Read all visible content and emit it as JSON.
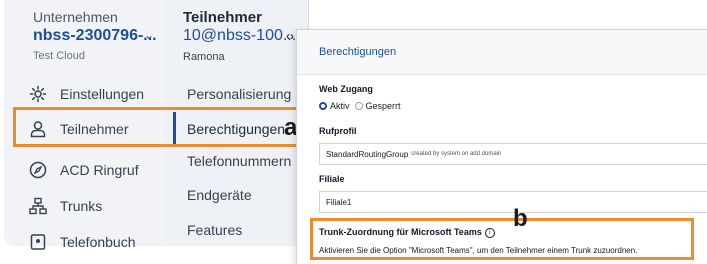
{
  "sidebar": {
    "tenant_label": "Unternehmen",
    "tenant_name": "nbss-2300796-...",
    "tenant_sub": "Test Cloud",
    "items": [
      {
        "label": "Einstellungen",
        "icon": "gear-icon"
      },
      {
        "label": "Teilnehmer",
        "icon": "user-icon"
      },
      {
        "label": "ACD Ringruf",
        "icon": "compass-icon"
      },
      {
        "label": "Trunks",
        "icon": "network-icon"
      },
      {
        "label": "Telefonbuch",
        "icon": "phonebook-icon"
      }
    ]
  },
  "submenu": {
    "title": "Teilnehmer",
    "account": "10@nbss-100...",
    "user": "Ramona",
    "items": [
      {
        "label": "Personalisierung"
      },
      {
        "label": "Berechtigungen"
      },
      {
        "label": "Telefonnummern"
      },
      {
        "label": "Endgeräte"
      },
      {
        "label": "Features"
      }
    ]
  },
  "panel": {
    "title": "Berechtigungen",
    "web_access_label": "Web Zugang",
    "web_access_options": [
      "Aktiv",
      "Gesperrt"
    ],
    "web_access_selected": "Aktiv",
    "routing_profile_label": "Rufprofil",
    "routing_profile_value": "StandardRoutingGroup",
    "routing_profile_note": "created by system on add domain",
    "branch_label": "Filiale",
    "branch_value": "Filiale1",
    "trunk_title": "Trunk-Zuordnung für Microsoft Teams",
    "trunk_text": "Aktivieren Sie die Option \"Microsoft Teams\", um den Teilnehmer einem Trunk zuzuordnen."
  },
  "annotations": {
    "marker_a": "a",
    "marker_b": "b",
    "highlight_color": "#ef8a2e"
  },
  "colors": {
    "accent": "#1f4e9c",
    "sidebar_bg": "#f1f3f6",
    "submenu_bg": "#eef1f5"
  }
}
